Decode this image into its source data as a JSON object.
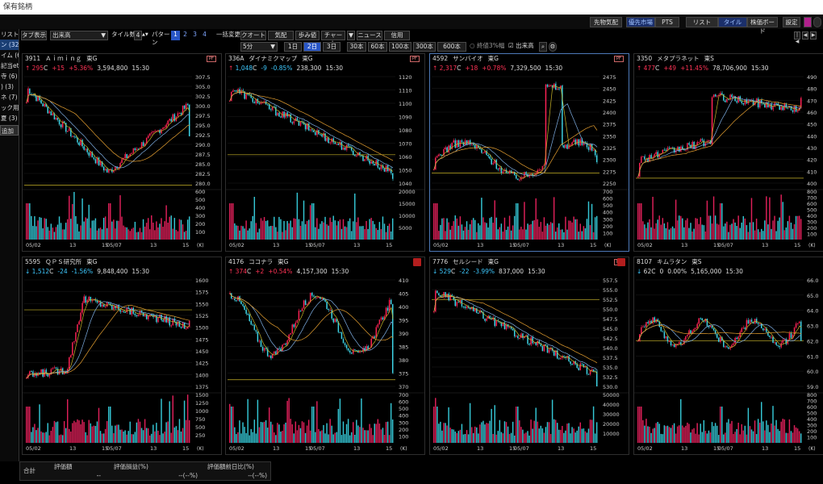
{
  "window": {
    "title": "保有銘柄"
  },
  "topbar": {
    "buttons": [
      "先物気配",
      "優先市場",
      "PTS",
      "リスト",
      "タイル",
      "株価ボード",
      "設定"
    ],
    "active": [
      "優先市場",
      "タイル"
    ]
  },
  "toolbar": {
    "tab_display_label": "タブ表示",
    "volume_select": "出来高",
    "tile_count_label": "タイル数",
    "tile_count_value": "4",
    "pattern_label": "パターン",
    "pattern_numbers": [
      "1",
      "2",
      "3",
      "4"
    ],
    "pattern_selected": "1",
    "bulk_change_label": "一括変更",
    "views": [
      "クオート",
      "気配",
      "歩み値",
      "チャート",
      "▼",
      "ニュース",
      "信用"
    ]
  },
  "toolbar2": {
    "interval_select": "5分",
    "periods": [
      "1日",
      "2日",
      "3日",
      "30本",
      "60本",
      "100本",
      "300本",
      "600本"
    ],
    "period_selected": "2日",
    "check_tick": "終値3%幅",
    "check_volume": "出来高"
  },
  "sidebar": {
    "items": [
      "リスト",
      "ン (32)",
      "イム (6)",
      "記当etf",
      "寺 (6)",
      ") (3)",
      "ネ (7)",
      "ック用 (",
      "夏 (3)"
    ],
    "selected": "ン (32)",
    "add_label": "追加"
  },
  "panels": [
    {
      "code": "3911",
      "name": "Ａｉｍｉｎｇ",
      "market": "東G",
      "direction": "up",
      "price": "295",
      "suffix": "C",
      "change": "+15",
      "pct": "+5.36%",
      "volume": "3,594,800",
      "time": "15:30",
      "tag": "PF",
      "yticks": [
        "307.5",
        "305.0",
        "302.5",
        "300.0",
        "297.5",
        "295.0",
        "292.5",
        "290.0",
        "287.5",
        "285.0",
        "282.5",
        "280.0"
      ],
      "vticks": [
        "600",
        "500",
        "400",
        "300",
        "200",
        "100"
      ],
      "dates": [
        "05/02",
        "13",
        "15",
        "05/07",
        "13",
        "15"
      ],
      "unit": "(K)",
      "series_start": 300,
      "series_end": 292,
      "series_low": 281,
      "series_high": 306,
      "ref_line": 280.5,
      "shape": "v"
    },
    {
      "code": "336A",
      "name": "ダイナミクマップ",
      "market": "東G",
      "direction": "up",
      "price": "1,048",
      "suffix": "C",
      "change": "-9",
      "pct": "-0.85%",
      "volume": "238,300",
      "time": "15:30",
      "tag": "PF",
      "yticks": [
        "1120",
        "1110",
        "1100",
        "1090",
        "1080",
        "1070",
        "1060",
        "1050",
        "1040"
      ],
      "vticks": [
        "20000",
        "15000",
        "10000",
        "5000"
      ],
      "dates": [
        "05/02",
        "13",
        "15",
        "05/07",
        "13",
        "15"
      ],
      "unit": "",
      "series_start": 1095,
      "series_end": 1040,
      "series_low": 1037,
      "series_high": 1112,
      "ref_line": 1057,
      "shape": "down"
    },
    {
      "code": "4592",
      "name": "サンバイオ",
      "market": "東G",
      "direction": "up",
      "price": "2,317",
      "suffix": "C",
      "change": "+18",
      "pct": "+0.78%",
      "volume": "7,329,500",
      "time": "15:30",
      "tag": "PF",
      "yticks": [
        "2475",
        "2450",
        "2425",
        "2400",
        "2375",
        "2350",
        "2325",
        "2300",
        "2275",
        "2250"
      ],
      "vticks": [
        "700",
        "600",
        "500",
        "400",
        "300",
        "200",
        "100"
      ],
      "dates": [
        "05/02",
        "13",
        "15",
        "05/07",
        "13",
        "15"
      ],
      "unit": "(K)",
      "series_start": 2305,
      "series_end": 2317,
      "series_low": 2282,
      "series_high": 2460,
      "ref_line": 2299,
      "shape": "spike"
    },
    {
      "code": "3350",
      "name": "メタプラネット",
      "market": "東S",
      "direction": "up",
      "price": "477",
      "suffix": "C",
      "change": "+49",
      "pct": "+11.45%",
      "volume": "78,706,900",
      "time": "15:30",
      "tag": "",
      "yticks": [
        "490",
        "480",
        "470",
        "460",
        "450",
        "440",
        "430",
        "420",
        "410",
        "400"
      ],
      "vticks": [
        "800",
        "700",
        "600",
        "500",
        "400",
        "300",
        "200",
        "100"
      ],
      "dates": [
        "05/02",
        "13",
        "15",
        "05/07",
        "13",
        "15"
      ],
      "unit": "(K)",
      "series_start": 429,
      "series_end": 477,
      "series_low": 425,
      "series_high": 490,
      "ref_line": 428,
      "shape": "gap"
    },
    {
      "code": "5595",
      "name": "ＱＰＳ研究所",
      "market": "東G",
      "direction": "down",
      "price": "1,512",
      "suffix": "C",
      "change": "-24",
      "pct": "-1.56%",
      "volume": "9,848,400",
      "time": "15:30",
      "tag": "",
      "yticks": [
        "1600",
        "1575",
        "1550",
        "1525",
        "1500",
        "1475",
        "1450",
        "1425",
        "1400",
        "1375"
      ],
      "vticks": [
        "1500",
        "1250",
        "1000",
        "750",
        "500",
        "250"
      ],
      "dates": [
        "05/02",
        "13",
        "15",
        "05/07",
        "13",
        "15"
      ],
      "unit": "(K)",
      "series_start": 1390,
      "series_end": 1512,
      "series_low": 1372,
      "series_high": 1600,
      "ref_line": 1536,
      "shape": "rise"
    },
    {
      "code": "4176",
      "name": "ココナラ",
      "market": "東G",
      "direction": "up",
      "price": "374",
      "suffix": "C",
      "change": "+2",
      "pct": "+0.54%",
      "volume": "4,157,300",
      "time": "15:30",
      "tag": "",
      "yticks": [
        "410",
        "405",
        "400",
        "395",
        "390",
        "385",
        "380",
        "375",
        "370"
      ],
      "vticks": [
        "700",
        "600",
        "500",
        "400",
        "300",
        "200",
        "100"
      ],
      "dates": [
        "05/02",
        "13",
        "15",
        "05/07",
        "13",
        "15"
      ],
      "unit": "(K)",
      "series_start": 398,
      "series_end": 374,
      "series_low": 370,
      "series_high": 402,
      "ref_line": 372,
      "shape": "w"
    },
    {
      "code": "7776",
      "name": "セルシード",
      "market": "東G",
      "direction": "down",
      "price": "529",
      "suffix": "C",
      "change": "-22",
      "pct": "-3.99%",
      "volume": "837,000",
      "time": "15:30",
      "tag": "PF",
      "yticks": [
        "557.5",
        "555.0",
        "552.5",
        "550.0",
        "547.5",
        "545.0",
        "542.5",
        "540.0",
        "537.5",
        "535.0",
        "532.5",
        "530.0"
      ],
      "vticks": [
        "50000",
        "40000",
        "30000",
        "20000",
        "10000"
      ],
      "dates": [
        "05/02",
        "13",
        "15",
        "05/07",
        "13",
        "15"
      ],
      "unit": "",
      "series_start": 548,
      "series_end": 529,
      "series_low": 529,
      "series_high": 556,
      "ref_line": 551,
      "shape": "down"
    },
    {
      "code": "8107",
      "name": "キムラタン",
      "market": "東S",
      "direction": "down",
      "price": "62",
      "suffix": "C",
      "change": "0",
      "pct": "0.00%",
      "volume": "5,165,000",
      "time": "15:30",
      "tag": "",
      "yticks": [
        "66.0",
        "65.0",
        "64.0",
        "63.0",
        "62.0",
        "61.0",
        "60.0",
        "59.0"
      ],
      "vticks": [
        "800",
        "700",
        "600",
        "500",
        "400",
        "300",
        "200",
        "100"
      ],
      "dates": [
        "05/02",
        "13",
        "15",
        "05/07",
        "13",
        "15"
      ],
      "unit": "(K)",
      "series_start": 62,
      "series_end": 62,
      "series_low": 59,
      "series_high": 66,
      "ref_line": 62,
      "shape": "flat"
    }
  ],
  "footer": {
    "total_label": "合計",
    "headers": [
      "評価額",
      "評価損益(%)",
      "評価額前日比(%)"
    ],
    "values": [
      "--",
      "--(--%)",
      "--(--%)"
    ]
  },
  "colors": {
    "up": "#ff2255",
    "down": "#3fd6e8",
    "volume_up": "#e0205a",
    "volume_down": "#35c8d6",
    "ma_short": "#c8b428",
    "ma_mid": "#7fb0e6",
    "ma_long": "#e6a030",
    "ref_line": "#c8b428",
    "selected_tab": "#2956c6",
    "panel_border_selected": "#4d79b8"
  }
}
